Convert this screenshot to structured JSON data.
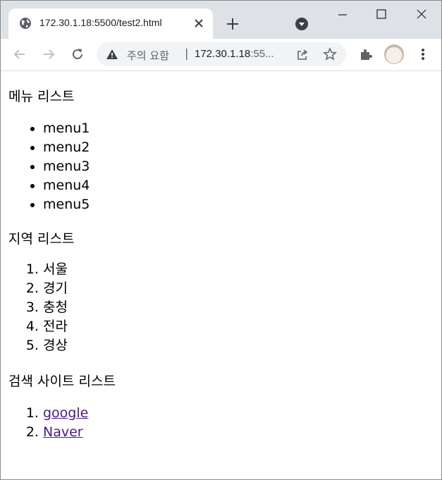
{
  "browser": {
    "tab_title": "172.30.1.18:5500/test2.html",
    "omnibox": {
      "security_label": "주의 요함",
      "separator": "|",
      "url_main": "172.30.1.18",
      "url_rest": ":55..."
    }
  },
  "page": {
    "menu_heading": "메뉴 리스트",
    "menu_items": [
      "menu1",
      "menu2",
      "menu3",
      "menu4",
      "menu5"
    ],
    "region_heading": "지역 리스트",
    "region_items": [
      "서울",
      "경기",
      "충청",
      "전라",
      "경상"
    ],
    "search_heading": "검색 사이트 리스트",
    "search_links": [
      "google",
      "Naver"
    ]
  },
  "colors": {
    "titlebar": "#dee1e6",
    "link_visited": "#4a1a8a"
  }
}
